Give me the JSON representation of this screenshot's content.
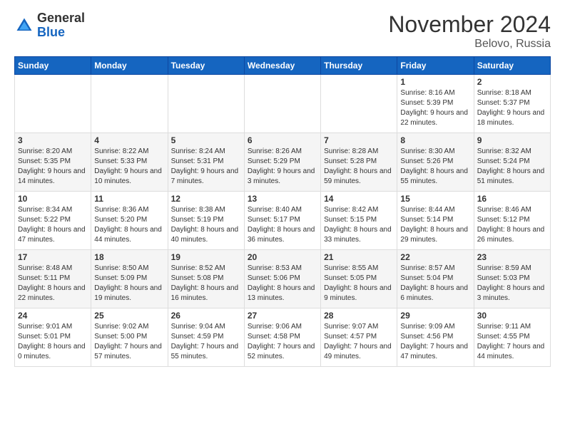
{
  "header": {
    "logo_general": "General",
    "logo_blue": "Blue",
    "month_title": "November 2024",
    "subtitle": "Belovo, Russia"
  },
  "weekdays": [
    "Sunday",
    "Monday",
    "Tuesday",
    "Wednesday",
    "Thursday",
    "Friday",
    "Saturday"
  ],
  "weeks": [
    [
      {
        "day": "",
        "info": ""
      },
      {
        "day": "",
        "info": ""
      },
      {
        "day": "",
        "info": ""
      },
      {
        "day": "",
        "info": ""
      },
      {
        "day": "",
        "info": ""
      },
      {
        "day": "1",
        "info": "Sunrise: 8:16 AM\nSunset: 5:39 PM\nDaylight: 9 hours and 22 minutes."
      },
      {
        "day": "2",
        "info": "Sunrise: 8:18 AM\nSunset: 5:37 PM\nDaylight: 9 hours and 18 minutes."
      }
    ],
    [
      {
        "day": "3",
        "info": "Sunrise: 8:20 AM\nSunset: 5:35 PM\nDaylight: 9 hours and 14 minutes."
      },
      {
        "day": "4",
        "info": "Sunrise: 8:22 AM\nSunset: 5:33 PM\nDaylight: 9 hours and 10 minutes."
      },
      {
        "day": "5",
        "info": "Sunrise: 8:24 AM\nSunset: 5:31 PM\nDaylight: 9 hours and 7 minutes."
      },
      {
        "day": "6",
        "info": "Sunrise: 8:26 AM\nSunset: 5:29 PM\nDaylight: 9 hours and 3 minutes."
      },
      {
        "day": "7",
        "info": "Sunrise: 8:28 AM\nSunset: 5:28 PM\nDaylight: 8 hours and 59 minutes."
      },
      {
        "day": "8",
        "info": "Sunrise: 8:30 AM\nSunset: 5:26 PM\nDaylight: 8 hours and 55 minutes."
      },
      {
        "day": "9",
        "info": "Sunrise: 8:32 AM\nSunset: 5:24 PM\nDaylight: 8 hours and 51 minutes."
      }
    ],
    [
      {
        "day": "10",
        "info": "Sunrise: 8:34 AM\nSunset: 5:22 PM\nDaylight: 8 hours and 47 minutes."
      },
      {
        "day": "11",
        "info": "Sunrise: 8:36 AM\nSunset: 5:20 PM\nDaylight: 8 hours and 44 minutes."
      },
      {
        "day": "12",
        "info": "Sunrise: 8:38 AM\nSunset: 5:19 PM\nDaylight: 8 hours and 40 minutes."
      },
      {
        "day": "13",
        "info": "Sunrise: 8:40 AM\nSunset: 5:17 PM\nDaylight: 8 hours and 36 minutes."
      },
      {
        "day": "14",
        "info": "Sunrise: 8:42 AM\nSunset: 5:15 PM\nDaylight: 8 hours and 33 minutes."
      },
      {
        "day": "15",
        "info": "Sunrise: 8:44 AM\nSunset: 5:14 PM\nDaylight: 8 hours and 29 minutes."
      },
      {
        "day": "16",
        "info": "Sunrise: 8:46 AM\nSunset: 5:12 PM\nDaylight: 8 hours and 26 minutes."
      }
    ],
    [
      {
        "day": "17",
        "info": "Sunrise: 8:48 AM\nSunset: 5:11 PM\nDaylight: 8 hours and 22 minutes."
      },
      {
        "day": "18",
        "info": "Sunrise: 8:50 AM\nSunset: 5:09 PM\nDaylight: 8 hours and 19 minutes."
      },
      {
        "day": "19",
        "info": "Sunrise: 8:52 AM\nSunset: 5:08 PM\nDaylight: 8 hours and 16 minutes."
      },
      {
        "day": "20",
        "info": "Sunrise: 8:53 AM\nSunset: 5:06 PM\nDaylight: 8 hours and 13 minutes."
      },
      {
        "day": "21",
        "info": "Sunrise: 8:55 AM\nSunset: 5:05 PM\nDaylight: 8 hours and 9 minutes."
      },
      {
        "day": "22",
        "info": "Sunrise: 8:57 AM\nSunset: 5:04 PM\nDaylight: 8 hours and 6 minutes."
      },
      {
        "day": "23",
        "info": "Sunrise: 8:59 AM\nSunset: 5:03 PM\nDaylight: 8 hours and 3 minutes."
      }
    ],
    [
      {
        "day": "24",
        "info": "Sunrise: 9:01 AM\nSunset: 5:01 PM\nDaylight: 8 hours and 0 minutes."
      },
      {
        "day": "25",
        "info": "Sunrise: 9:02 AM\nSunset: 5:00 PM\nDaylight: 7 hours and 57 minutes."
      },
      {
        "day": "26",
        "info": "Sunrise: 9:04 AM\nSunset: 4:59 PM\nDaylight: 7 hours and 55 minutes."
      },
      {
        "day": "27",
        "info": "Sunrise: 9:06 AM\nSunset: 4:58 PM\nDaylight: 7 hours and 52 minutes."
      },
      {
        "day": "28",
        "info": "Sunrise: 9:07 AM\nSunset: 4:57 PM\nDaylight: 7 hours and 49 minutes."
      },
      {
        "day": "29",
        "info": "Sunrise: 9:09 AM\nSunset: 4:56 PM\nDaylight: 7 hours and 47 minutes."
      },
      {
        "day": "30",
        "info": "Sunrise: 9:11 AM\nSunset: 4:55 PM\nDaylight: 7 hours and 44 minutes."
      }
    ]
  ]
}
